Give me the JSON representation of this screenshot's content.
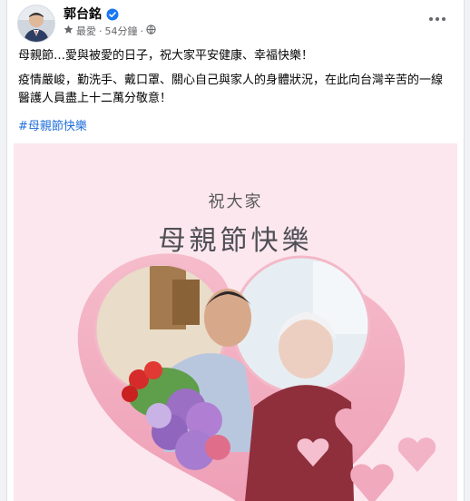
{
  "post": {
    "author": "郭台銘",
    "meta": {
      "privacy_label": "最愛",
      "separator": "·",
      "time": "54分鐘",
      "separator2": "·"
    },
    "paragraphs": [
      "母親節…愛與被愛的日子，祝大家平安健康、幸福快樂！",
      "疫情嚴峻，勤洗手、戴口罩、關心自己與家人的身體狀況，在此向台灣辛苦的一線醫護人員盡上十二萬分敬意！"
    ],
    "hashtag": "#母親節快樂"
  },
  "image_card": {
    "subtitle": "祝大家",
    "title": "母親節快樂"
  },
  "colors": {
    "verified": "#1877f2",
    "hashtag": "#216fdb",
    "card_background": "#fce7ee",
    "heart_pink": "#f2a9bf"
  },
  "icons": {
    "verified": "verified-badge-icon",
    "privacy_star": "star-icon",
    "audience": "globe-icon",
    "more": "more-options-icon"
  }
}
